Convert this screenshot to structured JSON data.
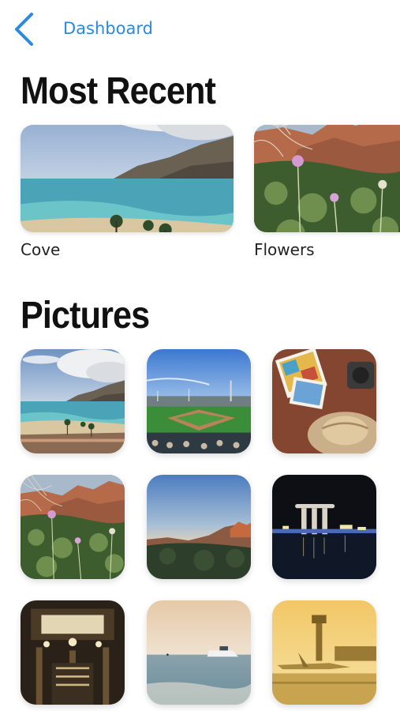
{
  "nav": {
    "back_icon": "chevron-left-icon",
    "title": "Dashboard",
    "accent_color": "#2a8ae0"
  },
  "most_recent": {
    "heading": "Most Recent",
    "items": [
      {
        "caption": "Cove",
        "image": "beach-cove-photo"
      },
      {
        "caption": "Flowers",
        "image": "desert-flowers-photo"
      }
    ]
  },
  "pictures": {
    "heading": "Pictures",
    "items": [
      {
        "image": "beach-cove-photo"
      },
      {
        "image": "baseball-stadium-photo"
      },
      {
        "image": "postcards-and-hat-photo"
      },
      {
        "image": "desert-flowers-photo"
      },
      {
        "image": "red-rock-sunset-photo"
      },
      {
        "image": "city-skyline-night-photo"
      },
      {
        "image": "ornate-ceiling-interior-photo"
      },
      {
        "image": "boat-on-sea-photo"
      },
      {
        "image": "airport-sunset-photo"
      }
    ]
  }
}
